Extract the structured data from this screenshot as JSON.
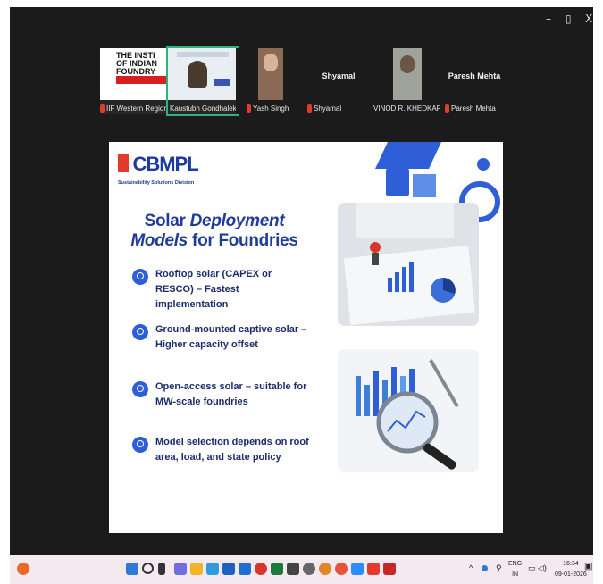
{
  "window": {
    "controls": [
      "–",
      "▯",
      "X"
    ]
  },
  "participants": [
    {
      "name": "IIF Western Region",
      "header_text": "THE INSTI\nOF INDIAN\nFOUNDRY\nWESTERN",
      "muted": true
    },
    {
      "name": "Kaustubh Gondhalekar",
      "muted": false,
      "active": true
    },
    {
      "name": "Yash Singh",
      "muted": true
    },
    {
      "name": "Shyamal",
      "big_name": "Shyamal",
      "muted": true
    },
    {
      "name": "VINOD R. KHEDKAR",
      "muted": false
    },
    {
      "name": "Paresh Mehta",
      "big_name": "Paresh Mehta",
      "muted": true
    }
  ],
  "slide": {
    "logo_text": "CBMPL",
    "logo_sub": "Sustainability Solutions Division",
    "title_line1_a": "Solar ",
    "title_line1_b": "Deployment",
    "title_line2_a": "Models",
    "title_line2_b": " for Foundries",
    "bullets": [
      "Rooftop solar (CAPEX or RESCO) – Fastest implementation",
      "Ground-mounted captive solar – Higher capacity offset",
      "Open-access solar – suitable for MW-scale foundries",
      "Model selection depends on roof area, load, and state policy"
    ]
  },
  "tray": {
    "lang_line1": "ENG",
    "lang_line2": "IN",
    "time": "16:34",
    "date": "09-01-2026"
  },
  "colors": {
    "accent_blue": "#2f5fd6",
    "title_blue": "#1f3b9b",
    "logo_red": "#e23b2d"
  }
}
